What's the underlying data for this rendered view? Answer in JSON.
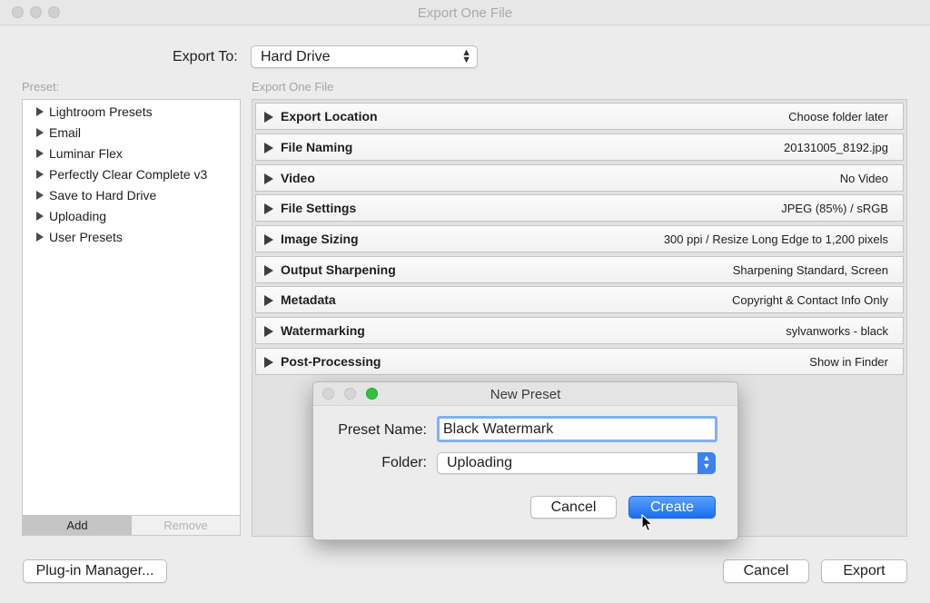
{
  "window": {
    "title": "Export One File"
  },
  "export_to": {
    "label": "Export To:",
    "value": "Hard Drive"
  },
  "presets": {
    "label": "Preset:",
    "items": [
      "Lightroom Presets",
      "Email",
      "Luminar Flex",
      "Perfectly Clear Complete v3",
      "Save to Hard Drive",
      "Uploading",
      "User Presets"
    ],
    "add_label": "Add",
    "remove_label": "Remove"
  },
  "sections": {
    "label": "Export One File",
    "rows": [
      {
        "name": "Export Location",
        "summary": "Choose folder later"
      },
      {
        "name": "File Naming",
        "summary": "20131005_8192.jpg"
      },
      {
        "name": "Video",
        "summary": "No Video"
      },
      {
        "name": "File Settings",
        "summary": "JPEG (85%) / sRGB"
      },
      {
        "name": "Image Sizing",
        "summary": "300 ppi / Resize Long Edge to 1,200 pixels"
      },
      {
        "name": "Output Sharpening",
        "summary": "Sharpening Standard, Screen"
      },
      {
        "name": "Metadata",
        "summary": "Copyright & Contact Info Only"
      },
      {
        "name": "Watermarking",
        "summary": "sylvanworks - black"
      },
      {
        "name": "Post-Processing",
        "summary": "Show in Finder"
      }
    ]
  },
  "footer": {
    "plugin_manager_label": "Plug-in Manager...",
    "cancel_label": "Cancel",
    "export_label": "Export"
  },
  "dialog": {
    "title": "New Preset",
    "preset_name_label": "Preset Name:",
    "preset_name_value": "Black Watermark",
    "folder_label": "Folder:",
    "folder_value": "Uploading",
    "cancel_label": "Cancel",
    "create_label": "Create"
  },
  "colors": {
    "accent": "#1a6ff0",
    "focus_ring": "#7fb2ee",
    "green_light": "#2fc23f"
  }
}
